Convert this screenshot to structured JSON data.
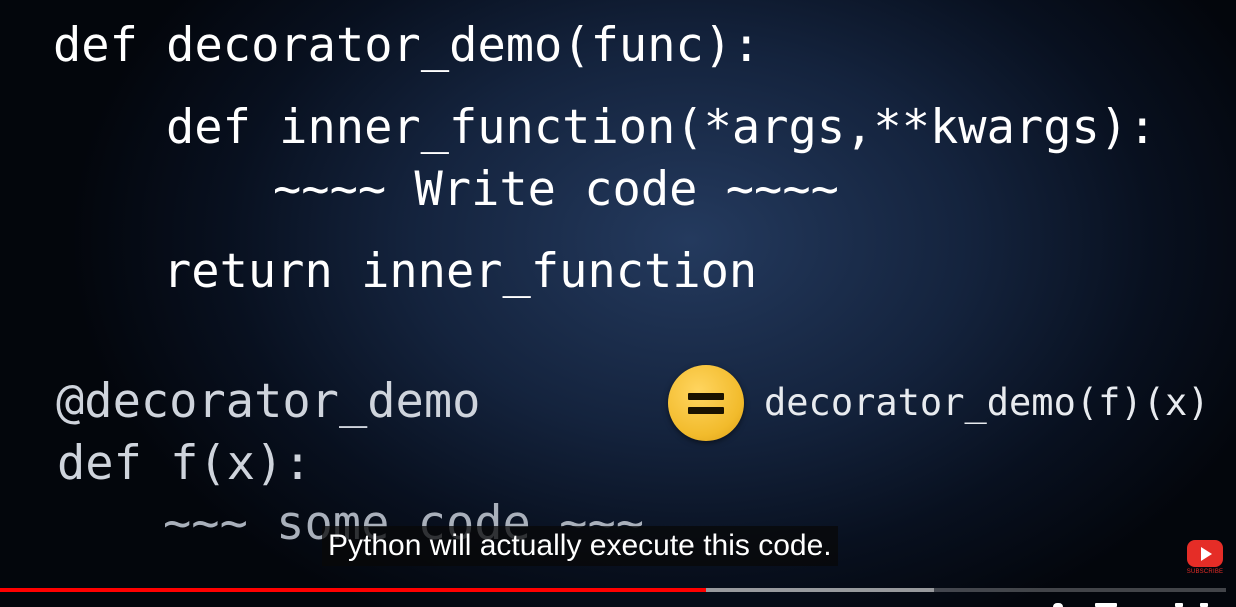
{
  "code": {
    "line_def_decorator": "def decorator_demo(func):",
    "line_def_inner": "def inner_function(*args,**kwargs):",
    "line_write_code": "~~~~ Write code ~~~~",
    "line_return": "return inner_function",
    "line_at_decorator": "@decorator_demo",
    "line_def_f": "def f(x):",
    "line_some_code": "~~~ some code ~~~"
  },
  "equivalence": {
    "symbol_icon": "equals-icon",
    "call_text": "decorator_demo(f)(x)"
  },
  "caption": {
    "text": "Python will actually execute this code."
  },
  "watermark": {
    "icon": "youtube-play-icon",
    "label": "SUBSCRIBE"
  },
  "player": {
    "progress_played_fraction": 0.576,
    "progress_buffered_fraction": 0.762,
    "colors": {
      "played": "#ff0000",
      "accent_badge": "#f2bb2c",
      "background": "#14233d"
    }
  }
}
